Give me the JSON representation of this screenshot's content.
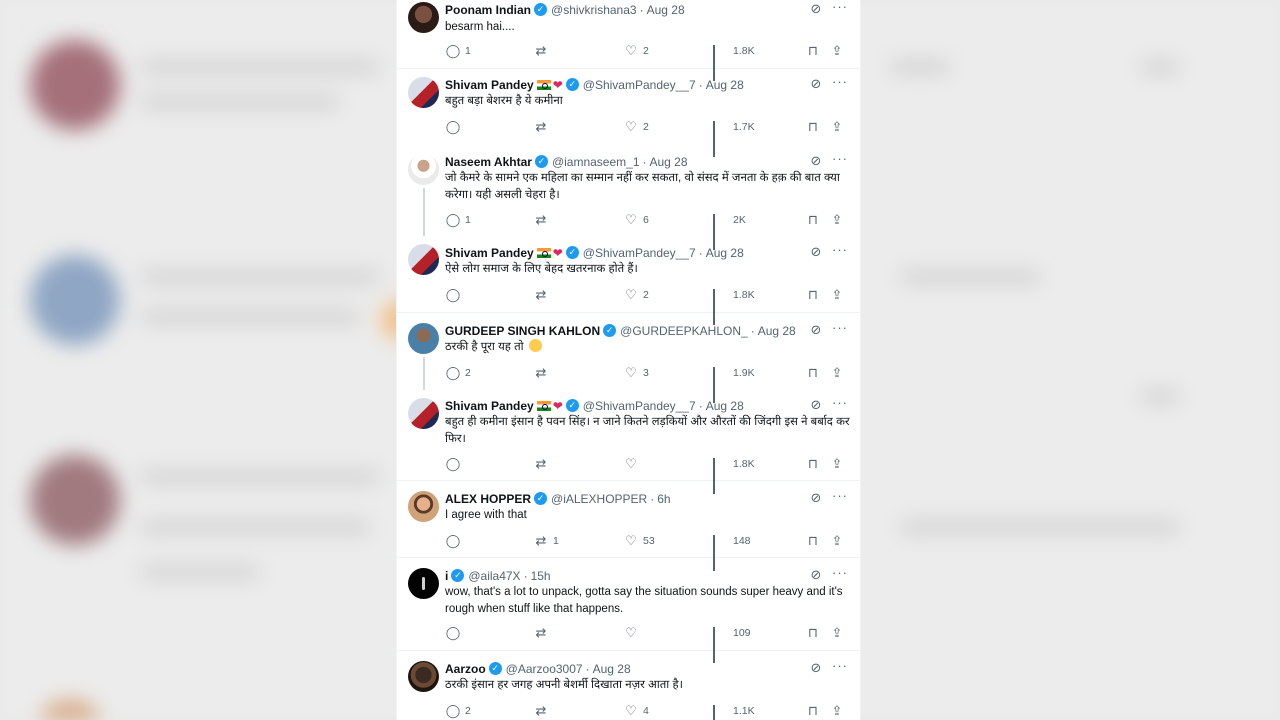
{
  "tweets": [
    {
      "name": "Poonam Indian",
      "handle": "@shivkrishana3",
      "time": "Aug 28",
      "text": "besarm hai....",
      "replies": "1",
      "retweets": "",
      "likes": "2",
      "views": "1.8K",
      "flag": false,
      "heart": false
    },
    {
      "name": "Shivam Pandey",
      "handle": "@ShivamPandey__7",
      "time": "Aug 28",
      "text": "बहुत बड़ा बेशरम है ये कमीना",
      "replies": "",
      "retweets": "",
      "likes": "2",
      "views": "1.7K",
      "flag": true,
      "heart": true
    },
    {
      "name": "Naseem Akhtar",
      "handle": "@iamnaseem_1",
      "time": "Aug 28",
      "text": "जो कैमरे के सामने एक महिला का सम्मान नहीं कर सकता, वो संसद में जनता के हक़ की बात क्या करेगा। यही असली चेहरा है।",
      "replies": "1",
      "retweets": "",
      "likes": "6",
      "views": "2K",
      "flag": false,
      "heart": false
    },
    {
      "name": "Shivam Pandey",
      "handle": "@ShivamPandey__7",
      "time": "Aug 28",
      "text": "ऐसे लोग समाज के लिए बेहद खतरनाक होते हैं।",
      "replies": "",
      "retweets": "",
      "likes": "2",
      "views": "1.8K",
      "flag": true,
      "heart": true
    },
    {
      "name": "GURDEEP SINGH KAHLON",
      "handle": "@GURDEEPKAHLON_",
      "time": "Aug 28",
      "text": "ठरकी है पूरा यह तो",
      "replies": "2",
      "retweets": "",
      "likes": "3",
      "views": "1.9K",
      "flag": false,
      "heart": false
    },
    {
      "name": "Shivam Pandey",
      "handle": "@ShivamPandey__7",
      "time": "Aug 28",
      "text": "बहुत ही कमीना इंसान है पवन सिंह। न जाने कितने लड़कियों और औरतों की जिंदगी इस ने बर्बाद कर फिर।",
      "replies": "",
      "retweets": "",
      "likes": "",
      "views": "1.8K",
      "flag": true,
      "heart": true
    },
    {
      "name": "ALEX HOPPER",
      "handle": "@iALEXHOPPER",
      "time": "6h",
      "text": "I agree with that",
      "replies": "",
      "retweets": "1",
      "likes": "53",
      "views": "148",
      "flag": false,
      "heart": false
    },
    {
      "name": "i",
      "handle": "@aila47X",
      "time": "15h",
      "text": "wow, that's a lot to unpack, gotta say the situation sounds super heavy and it's rough when stuff like that happens.",
      "replies": "",
      "retweets": "",
      "likes": "",
      "views": "109",
      "flag": false,
      "heart": false
    },
    {
      "name": "Aarzoo",
      "handle": "@Aarzoo3007",
      "time": "Aug 28",
      "text": "ठरकी इंसान हर जगह अपनी बेशर्मी दिखाता नज़र आता है।",
      "replies": "2",
      "retweets": "",
      "likes": "4",
      "views": "1.1K",
      "flag": false,
      "heart": false
    }
  ],
  "icons": {
    "reply": "reply-icon",
    "retweet": "retweet-icon",
    "like": "heart-icon",
    "views": "views-icon",
    "bookmark": "bookmark-icon",
    "share": "share-icon",
    "grok": "grok-icon",
    "more": "more-icon"
  },
  "colors": {
    "verified": "#1d9bf0",
    "secondary_text": "#536471",
    "primary_text": "#0f1419"
  }
}
